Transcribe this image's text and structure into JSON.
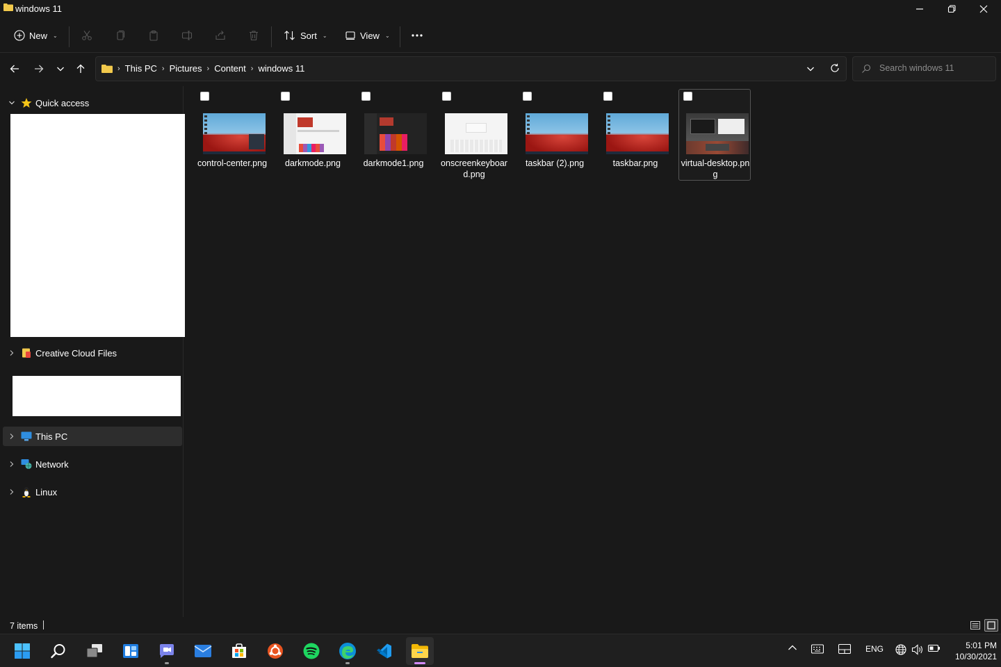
{
  "window": {
    "title": "windows 11"
  },
  "toolbar": {
    "new_label": "New",
    "sort_label": "Sort",
    "view_label": "View"
  },
  "breadcrumb": [
    "This PC",
    "Pictures",
    "Content",
    "windows 11"
  ],
  "search": {
    "placeholder": "Search windows 11"
  },
  "nav": {
    "quick_access": "Quick access",
    "creative_cloud": "Creative Cloud Files",
    "this_pc": "This PC",
    "network": "Network",
    "linux": "Linux"
  },
  "files": [
    {
      "name": "control-center.png",
      "thumb": "desktop"
    },
    {
      "name": "darkmode.png",
      "thumb": "light"
    },
    {
      "name": "darkmode1.png",
      "thumb": "dark"
    },
    {
      "name": "onscreenkeyboard.png",
      "thumb": "keyboard"
    },
    {
      "name": "taskbar (2).png",
      "thumb": "desktop"
    },
    {
      "name": "taskbar.png",
      "thumb": "desktop"
    },
    {
      "name": "virtual-desktop.png",
      "thumb": "virtual-desktop"
    }
  ],
  "status": {
    "item_count": "7 items"
  },
  "taskbar": {
    "apps": [
      "start",
      "search",
      "task-view",
      "widgets",
      "teams-chat",
      "mail",
      "store",
      "ubuntu",
      "spotify",
      "edge",
      "vscode",
      "file-explorer"
    ],
    "language": "ENG",
    "time": "5:01 PM",
    "date": "10/30/2021"
  },
  "colors": {
    "accent": "#d38bff",
    "folder": "#f2c94c",
    "background": "#191919"
  }
}
